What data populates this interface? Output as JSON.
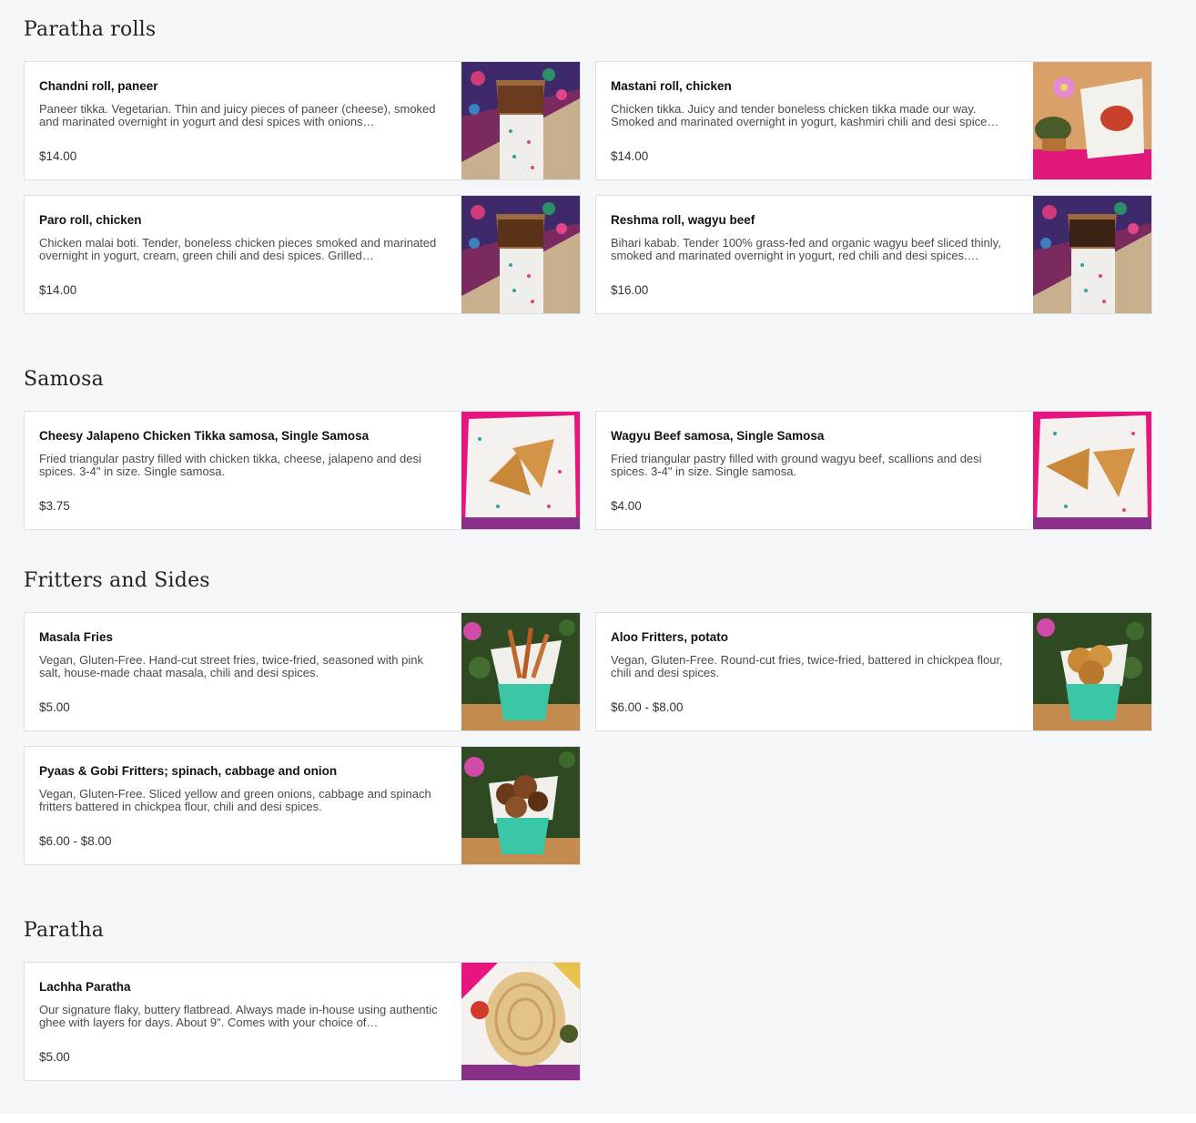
{
  "sections": [
    {
      "title": "Paratha rolls",
      "items": [
        {
          "name": "Chandni roll, paneer",
          "description": "Paneer tikka. Vegetarian. Thin and juicy pieces of paneer (cheese), smoked and marinated overnight in yogurt and desi spices with onions…",
          "price": "$14.00",
          "image": "paratha-roll-photo"
        },
        {
          "name": "Mastani roll, chicken",
          "description": "Chicken tikka. Juicy and tender boneless chicken tikka made our way. Smoked and marinated overnight in yogurt, kashmiri chili and desi spice…",
          "price": "$14.00",
          "image": "mastani-roll-photo"
        },
        {
          "name": "Paro roll, chicken",
          "description": "Chicken malai boti. Tender, boneless chicken pieces smoked and marinated overnight in yogurt, cream, green chili and desi spices. Grilled…",
          "price": "$14.00",
          "image": "paratha-roll-photo"
        },
        {
          "name": "Reshma roll, wagyu beef",
          "description": "Bihari kabab. Tender 100% grass-fed and organic wagyu beef sliced thinly, smoked and marinated overnight in yogurt, red chili and desi spices.…",
          "price": "$16.00",
          "image": "paratha-roll-photo"
        }
      ]
    },
    {
      "title": "Samosa",
      "items": [
        {
          "name": "Cheesy Jalapeno Chicken Tikka samosa, Single Samosa",
          "description": "Fried triangular pastry filled with chicken tikka, cheese, jalapeno and desi spices. 3-4\" in size. Single samosa.",
          "price": "$3.75",
          "image": "samosa-photo"
        },
        {
          "name": "Wagyu Beef samosa, Single Samosa",
          "description": "Fried triangular pastry filled with ground wagyu beef, scallions and desi spices. 3-4\" in size. Single samosa.",
          "price": "$4.00",
          "image": "samosa-photo"
        }
      ]
    },
    {
      "title": "Fritters and Sides",
      "items": [
        {
          "name": "Masala Fries",
          "description": "Vegan, Gluten-Free. Hand-cut street fries, twice-fried, seasoned with pink salt, house-made chaat masala, chili and desi spices.",
          "price": "$5.00",
          "image": "fries-basket-photo"
        },
        {
          "name": "Aloo Fritters, potato",
          "description": "Vegan, Gluten-Free. Round-cut fries, twice-fried, battered in chickpea flour, chili and desi spices.",
          "price": "$6.00 - $8.00",
          "image": "aloo-fritters-photo"
        },
        {
          "name": "Pyaas & Gobi Fritters; spinach, cabbage and onion",
          "description": "Vegan, Gluten-Free. Sliced yellow and green onions, cabbage and spinach fritters battered in chickpea flour, chili and desi spices.",
          "price": "$6.00 - $8.00",
          "image": "pakora-basket-photo"
        }
      ]
    },
    {
      "title": "Paratha",
      "items": [
        {
          "name": "Lachha Paratha",
          "description": "Our signature flaky, buttery flatbread. Always made in-house using authentic ghee with layers for days. About 9\". Comes with your choice of…",
          "price": "$5.00",
          "image": "paratha-flatbread-photo"
        }
      ]
    }
  ]
}
